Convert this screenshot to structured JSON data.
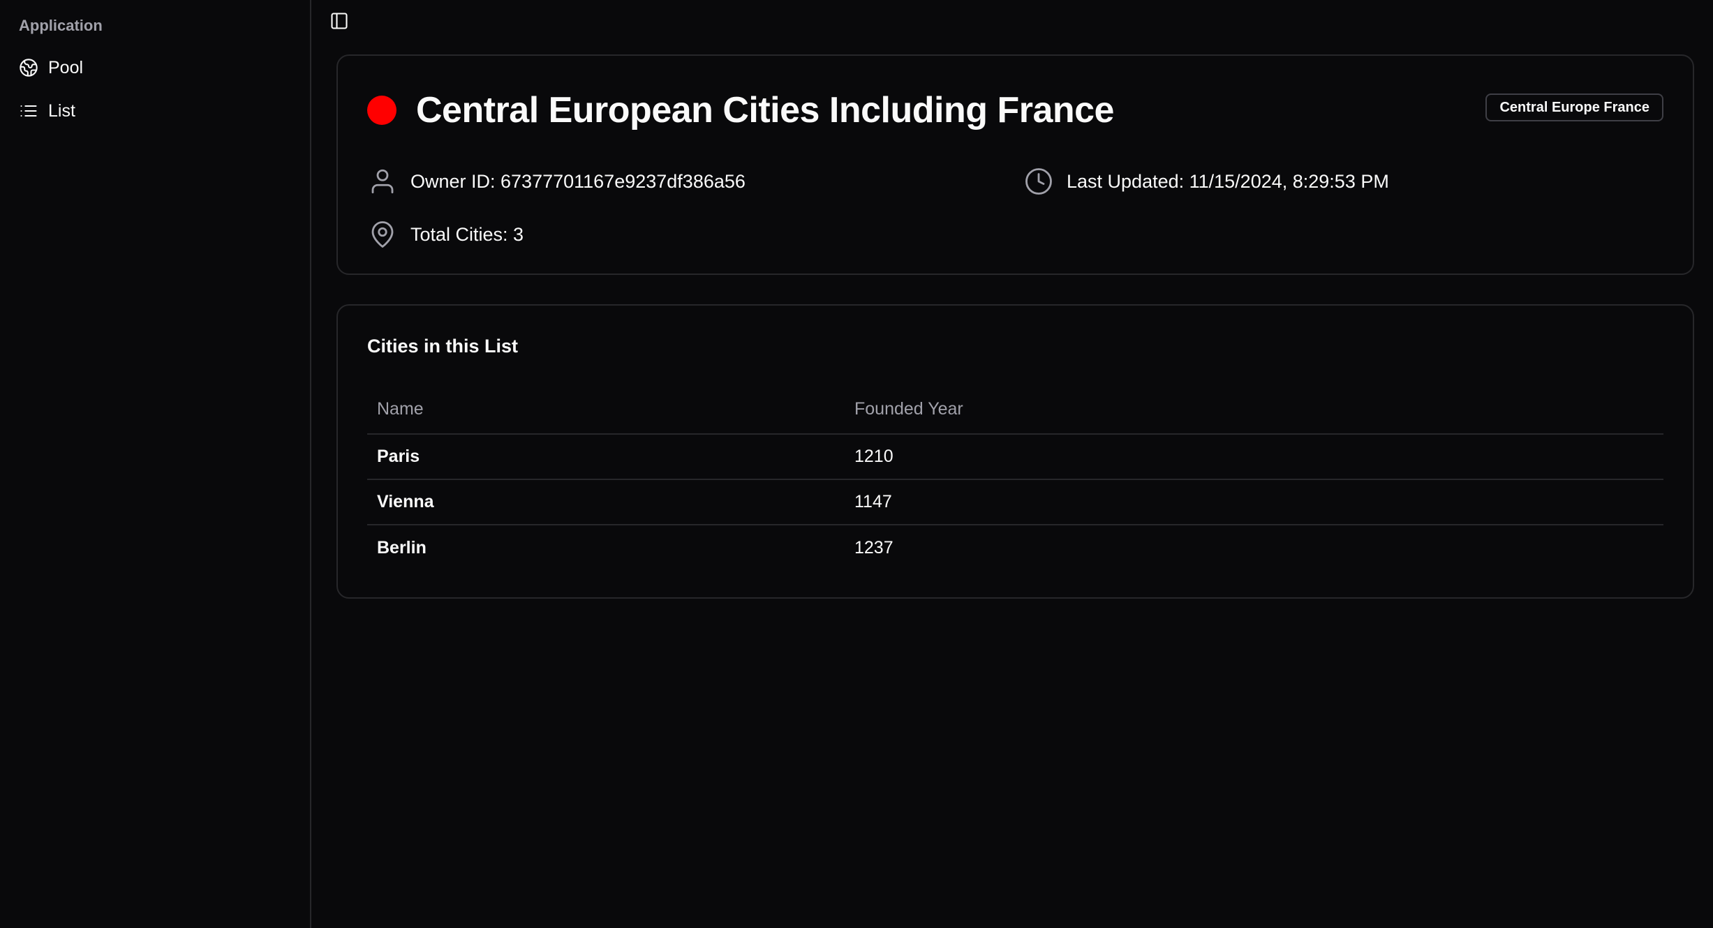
{
  "sidebar": {
    "group_label": "Application",
    "items": [
      {
        "label": "Pool",
        "icon": "globe-icon"
      },
      {
        "label": "List",
        "icon": "list-icon"
      }
    ]
  },
  "header": {
    "title": "Central European Cities Including France",
    "status_color": "#ff0000",
    "badge": "Central Europe France",
    "owner": "Owner ID: 67377701167e9237df386a56",
    "updated": "Last Updated: 11/15/2024, 8:29:53 PM",
    "total": "Total Cities: 3"
  },
  "cities": {
    "title": "Cities in this List",
    "columns": [
      "Name",
      "Founded Year"
    ],
    "rows": [
      {
        "name": "Paris",
        "year": "1210"
      },
      {
        "name": "Vienna",
        "year": "1147"
      },
      {
        "name": "Berlin",
        "year": "1237"
      }
    ]
  },
  "colors": {
    "background": "#09090b",
    "border": "#27272a",
    "muted_text": "#a1a1aa",
    "text": "#fafafa"
  }
}
